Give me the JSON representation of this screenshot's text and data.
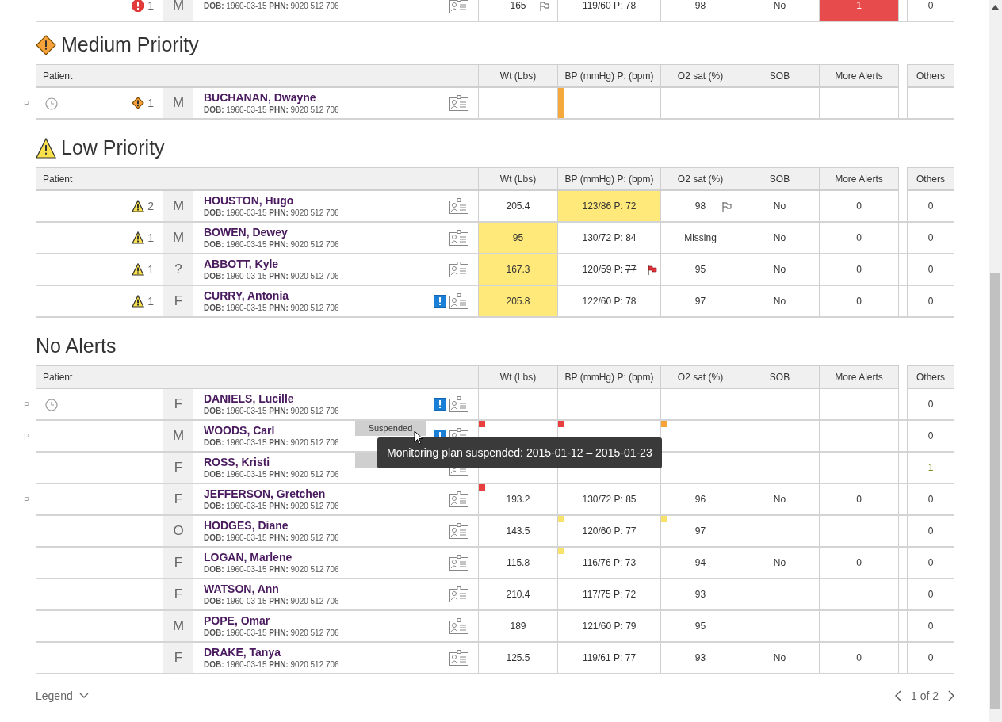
{
  "sections": [
    {
      "rows": [
        {
          "alert": {
            "kind": "high",
            "count": "1"
          },
          "sex": "M",
          "details": "**DOB:** 1960-03-15 **PHN:** 9020 512 706",
          "cells": [
            {
              "text": "165",
              "flag": {
                "kind": "outline"
              }
            },
            {
              "text": "119/60 P: 78"
            },
            {
              "text": "98"
            },
            {
              "text": "No"
            },
            {
              "text": "1",
              "color": "#e84b4b"
            }
          ],
          "others": {
            "text": "0"
          }
        }
      ]
    },
    {
      "title": "Medium Priority",
      "kind": "medium",
      "patient_header": "Patient",
      "columns": [
        "Wt (Lbs)",
        "BP (mmHg) P: (bpm)",
        "O2 sat (%)",
        "SOB",
        "More Alerts"
      ],
      "others_header": "Others",
      "rows": [
        {
          "pending": "P",
          "clock": true,
          "alert": {
            "kind": "medium",
            "count": "1"
          },
          "sex": "M",
          "name": "BUCHANAN, Dwayne",
          "details": "**DOB:** 1960-03-15 **PHN:** 9020 512 706",
          "cells": [
            null,
            {
              "stripe": {
                "color": "#f6a93b"
              }
            },
            null,
            null,
            null
          ],
          "others": null
        }
      ]
    },
    {
      "title": "Low Priority",
      "kind": "low",
      "patient_header": "Patient",
      "columns": [
        "Wt (Lbs)",
        "BP (mmHg) P: (bpm)",
        "O2 sat (%)",
        "SOB",
        "More Alerts"
      ],
      "others_header": "Others",
      "rows": [
        {
          "alert": {
            "kind": "low",
            "count": "2"
          },
          "sex": "M",
          "name": "HOUSTON, Hugo",
          "details": "**DOB:** 1960-03-15 **PHN:** 9020 512 706",
          "cells": [
            {
              "text": "205.4"
            },
            {
              "text": "123/86 P: 72",
              "color": "#fee97a"
            },
            {
              "text": "98",
              "flag": {
                "kind": "outline"
              }
            },
            {
              "text": "No"
            },
            {
              "text": "0"
            }
          ],
          "others": {
            "text": "0"
          }
        },
        {
          "alert": {
            "kind": "low",
            "count": "1"
          },
          "sex": "M",
          "name": "BOWEN, Dewey",
          "details": "**DOB:** 1960-03-15 **PHN:** 9020 512 706",
          "cells": [
            {
              "text": "95",
              "color": "#fee97a"
            },
            {
              "text": "130/72 P: 84"
            },
            {
              "text": "Missing"
            },
            {
              "text": "No"
            },
            {
              "text": "0"
            }
          ],
          "others": {
            "text": "0"
          }
        },
        {
          "alert": {
            "kind": "low",
            "count": "1"
          },
          "sex": "?",
          "name": "ABBOTT, Kyle",
          "details": "**DOB:** 1960-03-15 **PHN:** 9020 512 706",
          "cells": [
            {
              "text": "167.3",
              "color": "#fee97a"
            },
            {
              "text": "120/59 P:",
              "struck": "77",
              "flag": {
                "kind": "red"
              }
            },
            {
              "text": "95"
            },
            {
              "text": "No"
            },
            {
              "text": "0"
            }
          ],
          "others": {
            "text": "0"
          }
        },
        {
          "alert": {
            "kind": "low",
            "count": "1"
          },
          "sex": "F",
          "name": "CURRY, Antonia",
          "info": true,
          "details": "**DOB:** 1960-03-15 **PHN:** 9020 512 706",
          "cells": [
            {
              "text": "205.8",
              "color": "#fee97a"
            },
            {
              "text": "122/60 P: 78"
            },
            {
              "text": "97"
            },
            {
              "text": "No"
            },
            {
              "text": "0"
            }
          ],
          "others": {
            "text": "0"
          }
        }
      ]
    },
    {
      "title": "No Alerts",
      "patient_header": "Patient",
      "columns": [
        "Wt (Lbs)",
        "BP (mmHg) P: (bpm)",
        "O2 sat (%)",
        "SOB",
        "More Alerts"
      ],
      "others_header": "Others",
      "rows": [
        {
          "pending": "P",
          "clock": true,
          "sex": "F",
          "name": "DANIELS, Lucille",
          "info": true,
          "details": "**DOB:** 1960-03-15 **PHN:** 9020 512 706",
          "cells": [
            null,
            null,
            null,
            null,
            null
          ],
          "others": {
            "text": "0"
          }
        },
        {
          "pending": "P",
          "sex": "M",
          "name": "WOODS, Carl",
          "info": true,
          "tag": {
            "text": "Suspended"
          },
          "tooltip": "Monitoring plan suspended: 2015-01-12 – 2015-01-23",
          "details": "**DOB:** 1960-03-15 **PHN:** 9020 512 706",
          "cells": [
            {
              "marker": {
                "color": "#e84040"
              }
            },
            {
              "marker": {
                "color": "#e84040"
              }
            },
            {
              "marker": {
                "color": "#f5a33a"
              }
            },
            null,
            null
          ],
          "others": {
            "text": "0"
          }
        },
        {
          "sex": "F",
          "name": "ROSS, Kristi",
          "tag": {},
          "details": "**DOB:** 1960-03-15 **PHN:** 9020 512 706",
          "cells": [
            null,
            null,
            null,
            null,
            null
          ],
          "others": {
            "text": "1",
            "color": "#7a8f1e"
          }
        },
        {
          "pending": "P",
          "sex": "F",
          "name": "JEFFERSON, Gretchen",
          "details": "**DOB:** 1960-03-15 **PHN:** 9020 512 706",
          "cells": [
            {
              "text": "193.2",
              "marker": {
                "color": "#e84040"
              }
            },
            {
              "text": "130/72 P: 85"
            },
            {
              "text": "96"
            },
            {
              "text": "No"
            },
            {
              "text": "0"
            }
          ],
          "others": {
            "text": "0"
          }
        },
        {
          "sex": "O",
          "name": "HODGES, Diane",
          "details": "**DOB:** 1960-03-15 **PHN:** 9020 512 706",
          "cells": [
            {
              "text": "143.5"
            },
            {
              "text": "120/60 P: 77",
              "marker": {
                "color": "#f7e36a"
              }
            },
            {
              "text": "97",
              "marker": {
                "color": "#f7e36a"
              }
            },
            null,
            null
          ],
          "others": {
            "text": "0"
          }
        },
        {
          "sex": "F",
          "name": "LOGAN, Marlene",
          "details": "**DOB:** 1960-03-15 **PHN:** 9020 512 706",
          "cells": [
            {
              "text": "115.8"
            },
            {
              "text": "116/76 P: 73",
              "marker": {
                "color": "#f7e36a"
              }
            },
            {
              "text": "94"
            },
            {
              "text": "No"
            },
            {
              "text": "0"
            }
          ],
          "others": {
            "text": "0"
          }
        },
        {
          "sex": "F",
          "name": "WATSON, Ann",
          "details": "**DOB:** 1960-03-15 **PHN:** 9020 512 706",
          "cells": [
            {
              "text": "210.4"
            },
            {
              "text": "117/75 P: 72"
            },
            {
              "text": "93"
            },
            null,
            null
          ],
          "others": {
            "text": "0"
          }
        },
        {
          "sex": "M",
          "name": "POPE, Omar",
          "details": "**DOB:** 1960-03-15 **PHN:** 9020 512 706",
          "cells": [
            {
              "text": "189"
            },
            {
              "text": "121/60 P: 79"
            },
            {
              "text": "95"
            },
            null,
            null
          ],
          "others": {
            "text": "0"
          }
        },
        {
          "sex": "F",
          "name": "DRAKE, Tanya",
          "details": "**DOB:** 1960-03-15 **PHN:** 9020 512 706",
          "cells": [
            {
              "text": "125.5"
            },
            {
              "text": "119/61 P: 77"
            },
            {
              "text": "93"
            },
            {
              "text": "No"
            },
            {
              "text": "0"
            }
          ],
          "others": {
            "text": "0"
          }
        }
      ]
    }
  ],
  "legend": {
    "label": "Legend"
  },
  "pager": {
    "text": "1 of 2"
  }
}
